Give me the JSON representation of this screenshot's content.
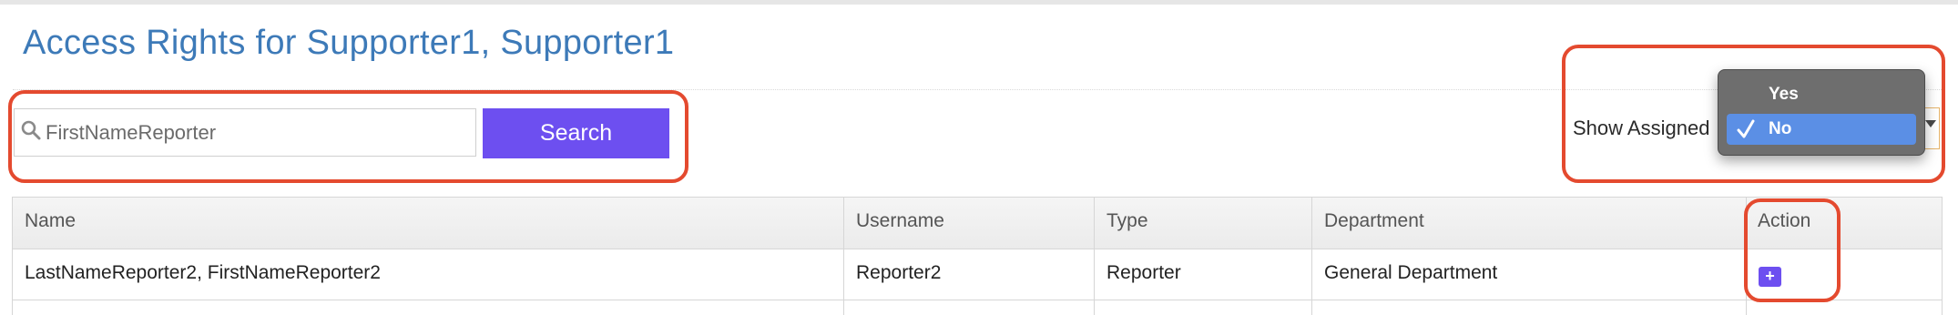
{
  "title": "Access Rights for Supporter1, Supporter1",
  "search": {
    "placeholder": "FirstNameReporter",
    "value": "",
    "button_label": "Search"
  },
  "show_assigned": {
    "label": "Show Assigned",
    "options": [
      {
        "label": "Yes",
        "selected": false
      },
      {
        "label": "No",
        "selected": true
      }
    ]
  },
  "table": {
    "columns": [
      "Name",
      "Username",
      "Type",
      "Department",
      "Action"
    ],
    "rows": [
      {
        "name": "LastNameReporter2, FirstNameReporter2",
        "username": "Reporter2",
        "type": "Reporter",
        "department": "General Department",
        "action_label": "+"
      }
    ]
  },
  "colors": {
    "title": "#3d7ab8",
    "accent": "#6d4ff0",
    "highlight": "#e44a2f",
    "dropdown_selected": "#5b8fe5"
  },
  "icons": {
    "search": "search-icon",
    "check": "check-icon",
    "dropdown_arrow": "chevron-down-icon",
    "add": "add-icon"
  }
}
